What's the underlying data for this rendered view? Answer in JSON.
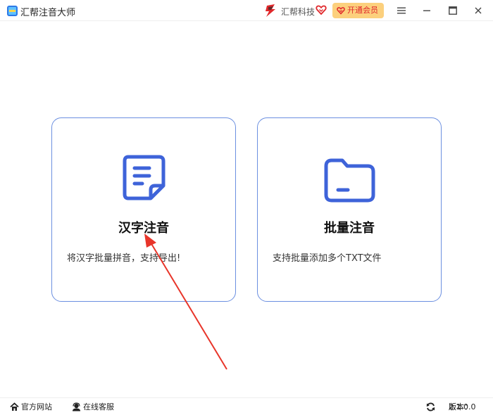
{
  "app": {
    "title": "汇帮注音大师"
  },
  "header": {
    "brand_name": "汇帮科技",
    "vip_label": "开通会员",
    "accent_color": "#e0282b",
    "vip_bg_color": "#fcd07d",
    "icons": [
      "app-logo-icon",
      "brand-logo-icon",
      "heart-icon",
      "menu-icon",
      "minimize-icon",
      "maximize-icon",
      "close-icon"
    ]
  },
  "cards": [
    {
      "title": "汉字注音",
      "description": "将汉字批量拼音，支持导出!",
      "icon": "document-icon"
    },
    {
      "title": "批量注音",
      "description": "支持批量添加多个TXT文件",
      "icon": "folder-icon"
    }
  ],
  "footer": {
    "website_label": "官方网站",
    "service_label": "在线客服",
    "version_label": "版本：",
    "version_value": "2.1.0.0"
  },
  "colors": {
    "card_border": "#6b8fe0",
    "icon_blue": "#3e63d9",
    "annotation_arrow": "#e8352a"
  }
}
